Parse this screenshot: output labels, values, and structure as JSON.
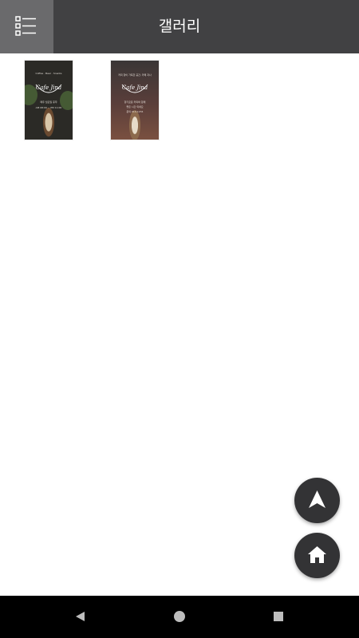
{
  "header": {
    "title": "갤러리",
    "menu_icon": "list-menu-icon"
  },
  "gallery": {
    "items": [
      {
        "icon": "cafe-menu-image",
        "lines": [
          "Coffee · Beer · Snacks",
          "Cafe Jina",
          "매주 월요일 휴무",
          "AM 08:00 ~ PM 11:00"
        ]
      },
      {
        "icon": "cafe-menu-image",
        "lines": [
          "커피 향이 가득한 공간, 카페 지나",
          "Cafe Jina",
          "향기로운 커피와 함께",
          "좋은 시간 되세요",
          "문의 010-1234"
        ]
      }
    ]
  },
  "fabs": {
    "scroll_top_icon": "navigation-arrow-icon",
    "home_icon": "home-icon"
  },
  "system_nav": {
    "back_icon": "back-triangle-icon",
    "home_icon": "home-circle-icon",
    "recents_icon": "recents-square-icon"
  },
  "colors": {
    "header_bg": "#414143",
    "menu_button_bg": "#6a6a6c",
    "fab_bg": "#333335",
    "nav_bg": "#000000"
  }
}
